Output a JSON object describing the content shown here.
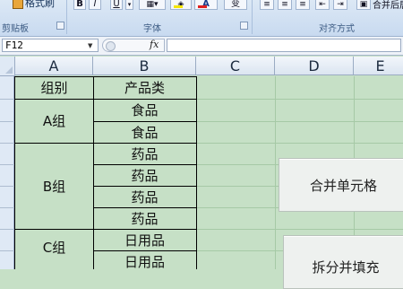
{
  "ribbon": {
    "format_painter": "格式刷",
    "groups": {
      "clipboard": "剪贴板",
      "font": "字体",
      "alignment": "对齐方式"
    },
    "buttons": {
      "bold": "B",
      "italic": "I",
      "underline": "U",
      "font_color": "A",
      "phonetic": "变"
    },
    "merge_label": "合并后居"
  },
  "formula_bar": {
    "name_box": "F12",
    "fx": "fx",
    "formula": ""
  },
  "grid": {
    "columns": [
      "A",
      "B",
      "C",
      "D",
      "E"
    ],
    "cells": {
      "a1": "组别",
      "b1": "产品类",
      "a_group1": "A组",
      "a_group2": "B组",
      "a_group3": "C组",
      "b_values": [
        "食品",
        "食品",
        "药品",
        "药品",
        "药品",
        "药品",
        "日用品",
        "日用品"
      ]
    },
    "colors": {
      "sheet_background": "#c6e0c6",
      "header_blue": "#dfe9f5"
    }
  },
  "actions": {
    "merge_cells": "合并单元格",
    "split_fill": "拆分并填充"
  }
}
